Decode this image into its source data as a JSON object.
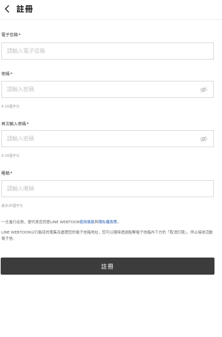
{
  "header": {
    "title": "註冊",
    "back_icon": "chevron-left-icon"
  },
  "form": {
    "email": {
      "label": "電子信箱",
      "required_mark": "*",
      "placeholder": "請輸入電子信箱"
    },
    "password": {
      "label": "密碼",
      "required_mark": "*",
      "placeholder": "請輸入密碼",
      "hint": "6-16個字元",
      "toggle_icon": "eye-off-icon"
    },
    "password_confirm": {
      "label": "再次輸入密碼",
      "required_mark": "*",
      "placeholder": "請輸入密碼",
      "hint": "6-16個字元",
      "toggle_icon": "eye-off-icon"
    },
    "nickname": {
      "label": "暱稱",
      "required_mark": "*",
      "placeholder": "請輸入暱稱",
      "hint": "最多20個字元"
    }
  },
  "notice": {
    "agree_prefix": "一旦進行註冊，便代表您同意LINE WEBTOON",
    "terms_link": "使用條款",
    "and": "與",
    "privacy_link": "隱私權政策",
    "agree_suffix": "。",
    "marketing": "LINE WEBTOON以行銷目的蒐集及處理您的電子信箱地址，您可以隨時透過點擊電子信箱內下方的「取消訂閱」，停止接收活動電子信。"
  },
  "submit_label": "註冊",
  "colors": {
    "button_bg": "#3c3c3c",
    "link": "#2a5fb5",
    "border": "#dcdcdc"
  }
}
